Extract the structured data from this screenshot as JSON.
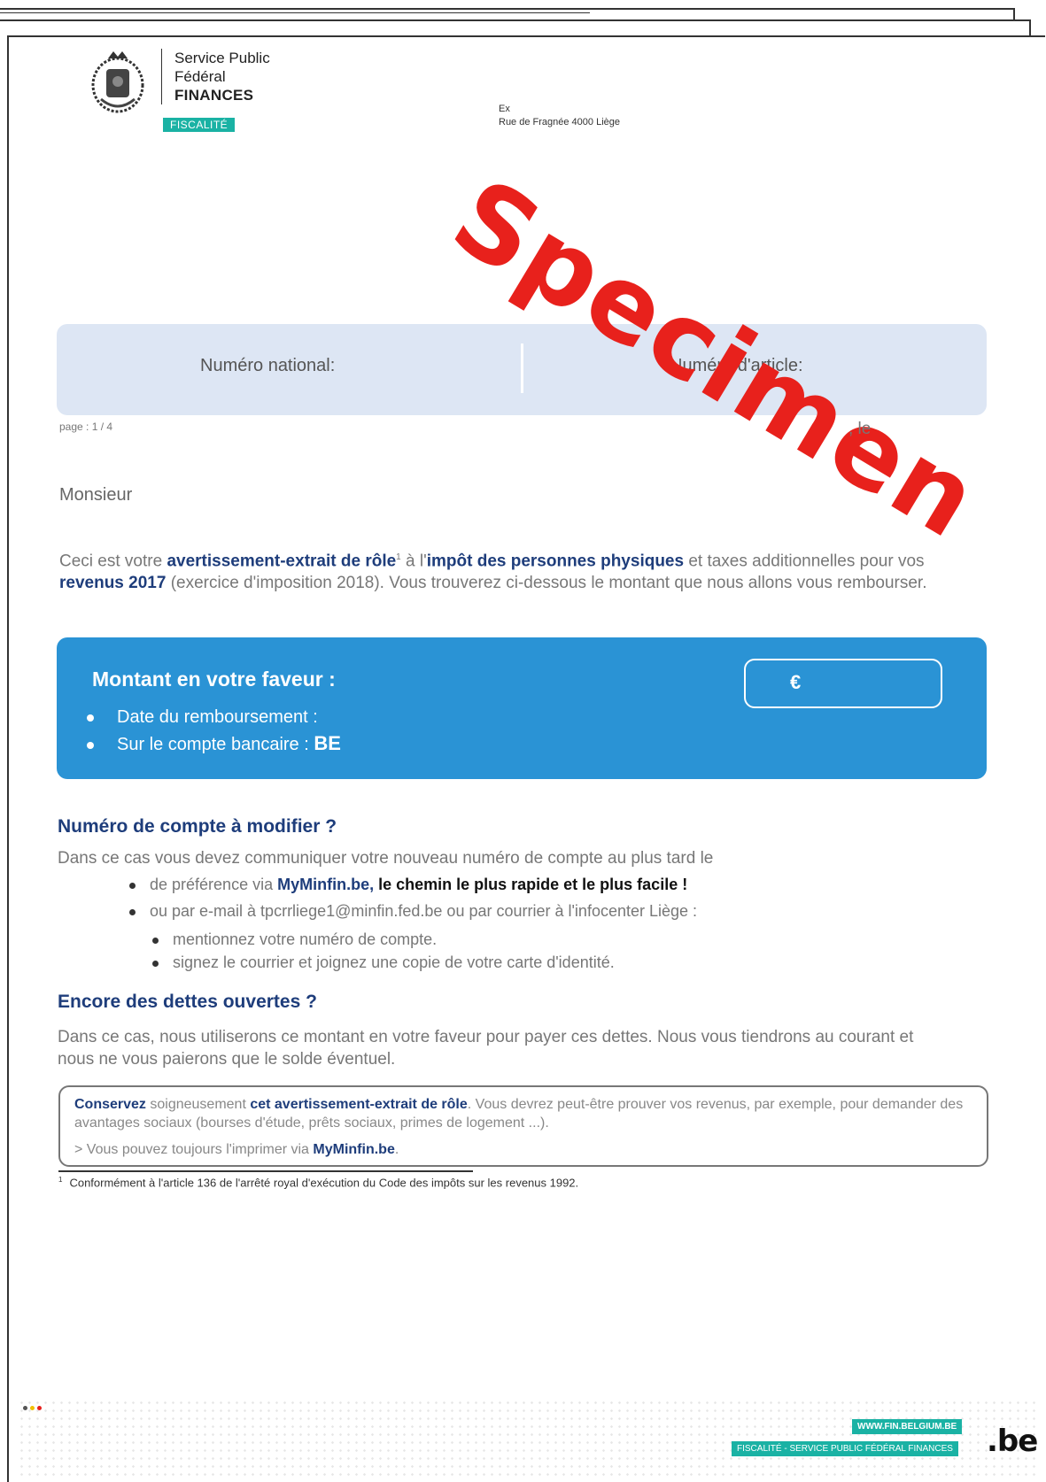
{
  "header": {
    "brand_line1": "Service Public",
    "brand_line2": "Fédéral",
    "brand_line3": "FINANCES",
    "fiscalite": "FISCALITÉ",
    "sender_line1": "Ex",
    "sender_line2": "Rue de Fragnée 4000 Liège",
    "watermark": "Specimen"
  },
  "id_box": {
    "national_label": "Numéro national:",
    "article_label": "Numéro d'article:"
  },
  "meta": {
    "page": "page : 1 / 4",
    "date_suffix": ", le"
  },
  "greeting": "Monsieur",
  "intro": {
    "p1": "Ceci est votre ",
    "b1": "avertissement-extrait de rôle",
    "sup": "1",
    "p2": " à l'",
    "b2": "impôt des personnes physiques",
    "p3": " et taxes additionnelles pour vos ",
    "b3": "revenus 2017",
    "p4": " (exercice d'imposition 2018). Vous trouverez ci-dessous le montant que nous allons vous rembourser."
  },
  "amount_box": {
    "title": "Montant en votre faveur :",
    "currency": "€",
    "item1": "Date du remboursement :",
    "item2_prefix": "Sur le compte bancaire : ",
    "item2_bold": "BE"
  },
  "modify": {
    "heading": "Numéro de compte à modifier ?",
    "text": "Dans ce cas vous devez communiquer votre nouveau numéro de compte au plus tard le",
    "b1_prefix": "de préférence via ",
    "b1_link": "MyMinfin.be,",
    "b1_bold": " le chemin le plus rapide et le plus facile !",
    "b2": "ou par e-mail à tpcrrliege1@minfin.fed.be ou par courrier à l'infocenter Liège :",
    "b3": "mentionnez votre numéro de compte.",
    "b4": "signez le courrier et joignez une copie de votre carte d'identité."
  },
  "debts": {
    "heading": "Encore des dettes ouvertes ?",
    "text": "Dans ce cas, nous utiliserons ce montant en votre faveur pour payer ces dettes. Nous vous tiendrons au courant et nous ne vous paierons que le solde éventuel."
  },
  "note": {
    "b1": "Conservez",
    "t1": " soigneusement ",
    "b2": "cet avertissement-extrait de rôle",
    "t2": ". Vous devrez peut-être prouver vos revenus, par exemple, pour demander des avantages sociaux (bourses d'étude, prêts sociaux, primes de logement ...).",
    "t3": ">  Vous pouvez toujours l'imprimer via ",
    "b3": "MyMinfin.be",
    "t4": "."
  },
  "footnote": {
    "num": "1",
    "text": "Conformément à l'article 136 de l'arrêté royal d'exécution du Code des impôts sur les revenus 1992."
  },
  "footer": {
    "url": "WWW.FIN.BELGIUM.BE",
    "service": "FISCALITÉ - SERVICE PUBLIC FÉDÉRAL FINANCES",
    "be": ".be"
  }
}
